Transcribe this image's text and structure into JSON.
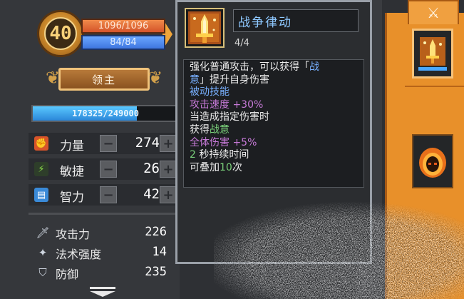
{
  "character": {
    "level": "40",
    "hp": "1096/1096",
    "mp": "84/84",
    "title": "领主",
    "xp_text": "178325/249000",
    "xp_fraction": 0.716
  },
  "stats": [
    {
      "label": "力量",
      "value": "274",
      "icon": "strength-fist-icon",
      "icon_color": "#d8542a"
    },
    {
      "label": "敏捷",
      "value": "26",
      "icon": "agility-feather-icon",
      "icon_color": "#4aa84a"
    },
    {
      "label": "智力",
      "value": "42",
      "icon": "intelligence-book-icon",
      "icon_color": "#3a8ad8"
    }
  ],
  "attributes": [
    {
      "label": "攻击力",
      "value": "226",
      "icon": "sword-icon"
    },
    {
      "label": "法术强度",
      "value": "14",
      "icon": "wand-icon"
    },
    {
      "label": "防御",
      "value": "235",
      "icon": "shield-icon"
    }
  ],
  "tooltip": {
    "title": "战争律动",
    "stack": "4/4",
    "lines": [
      [
        {
          "t": "强化普通攻击，可以获得「",
          "c": "white"
        },
        {
          "t": "战",
          "c": "blue"
        }
      ],
      [
        {
          "t": "意",
          "c": "blue"
        },
        {
          "t": "」提升自身伤害",
          "c": "white"
        }
      ],
      [
        {
          "t": "被动技能",
          "c": "blue"
        }
      ],
      [
        {
          "t": "攻击速度 +30%",
          "c": "purple"
        }
      ],
      [
        {
          "t": "当造成指定伤害时",
          "c": "white"
        }
      ],
      [
        {
          "t": "获得",
          "c": "white"
        },
        {
          "t": "战意",
          "c": "green"
        }
      ],
      [
        {
          "t": "全体伤害 +5%",
          "c": "purple"
        }
      ],
      [
        {
          "t": "2",
          "c": "green"
        },
        {
          "t": " 秒持续时间",
          "c": "white"
        }
      ],
      [
        {
          "t": "可叠加",
          "c": "white"
        },
        {
          "t": "10",
          "c": "green"
        },
        {
          "t": "次",
          "c": "white"
        }
      ]
    ]
  },
  "side_panel": {
    "tab_icon": "crossed-swords-icon",
    "slots": [
      {
        "icon": "golden-sword-skill-icon",
        "selected": true
      },
      {
        "icon": "fire-skull-skill-icon",
        "selected": false
      }
    ]
  }
}
